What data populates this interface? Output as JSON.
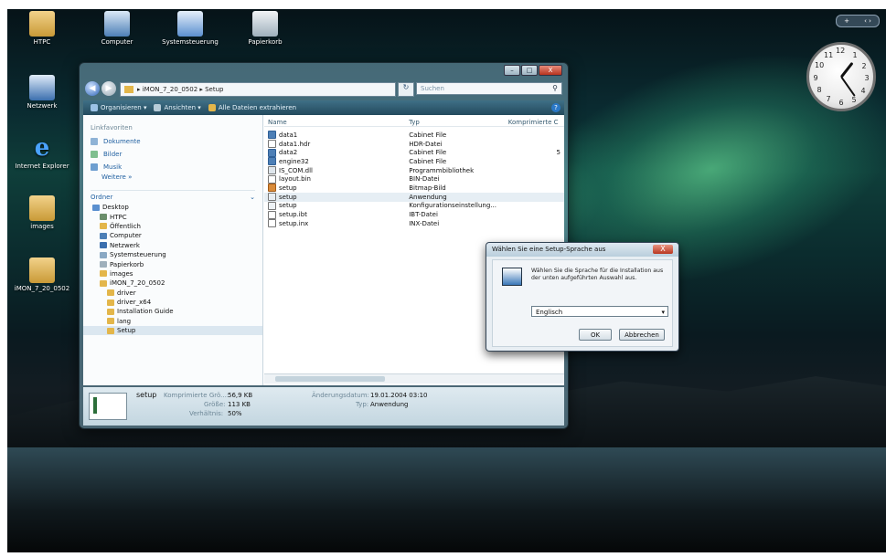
{
  "desktop_icons": [
    {
      "label": "HTPC",
      "icon": "folder-icon"
    },
    {
      "label": "Computer",
      "icon": "computer-icon"
    },
    {
      "label": "Systemsteuerung",
      "icon": "control-panel-icon"
    },
    {
      "label": "Papierkorb",
      "icon": "recycle-bin-icon"
    },
    {
      "label": "Netzwerk",
      "icon": "network-icon"
    },
    {
      "label": "Internet Explorer",
      "icon": "ie-icon"
    },
    {
      "label": "images",
      "icon": "folder-icon"
    },
    {
      "label": "iMON_7_20_0502",
      "icon": "folder-icon"
    }
  ],
  "explorer": {
    "breadcrumb": "▸ iMON_7_20_0502 ▸ Setup",
    "search_placeholder": "Suchen",
    "toolbar": {
      "organize": "Organisieren ▾",
      "views": "Ansichten ▾",
      "extract": "Alle Dateien extrahieren"
    },
    "favorites_header": "Linkfavoriten",
    "favorites": [
      "Dokumente",
      "Bilder",
      "Musik"
    ],
    "more": "Weitere »",
    "folders_header": "Ordner",
    "tree": [
      {
        "label": "Desktop",
        "level": 0
      },
      {
        "label": "HTPC",
        "level": 1
      },
      {
        "label": "Öffentlich",
        "level": 1
      },
      {
        "label": "Computer",
        "level": 1
      },
      {
        "label": "Netzwerk",
        "level": 1
      },
      {
        "label": "Systemsteuerung",
        "level": 1
      },
      {
        "label": "Papierkorb",
        "level": 1
      },
      {
        "label": "images",
        "level": 1
      },
      {
        "label": "iMON_7_20_0502",
        "level": 1
      },
      {
        "label": "driver",
        "level": 2
      },
      {
        "label": "driver_x64",
        "level": 2
      },
      {
        "label": "Installation Guide",
        "level": 2
      },
      {
        "label": "lang",
        "level": 2
      },
      {
        "label": "Setup",
        "level": 2,
        "selected": true
      }
    ],
    "columns": [
      "Name",
      "Typ",
      "Komprimierte C"
    ],
    "files": [
      {
        "name": "data1",
        "type": "Cabinet File",
        "comp": ""
      },
      {
        "name": "data1.hdr",
        "type": "HDR-Datei",
        "comp": ""
      },
      {
        "name": "data2",
        "type": "Cabinet File",
        "comp": "5"
      },
      {
        "name": "engine32",
        "type": "Cabinet File",
        "comp": ""
      },
      {
        "name": "IS_COM.dll",
        "type": "Programmbibliothek",
        "comp": ""
      },
      {
        "name": "layout.bin",
        "type": "BIN-Datei",
        "comp": ""
      },
      {
        "name": "setup",
        "type": "Bitmap-Bild",
        "comp": ""
      },
      {
        "name": "setup",
        "type": "Anwendung",
        "comp": "",
        "highlight": true
      },
      {
        "name": "setup",
        "type": "Konfigurationseinstellung...",
        "comp": ""
      },
      {
        "name": "setup.ibt",
        "type": "IBT-Datei",
        "comp": ""
      },
      {
        "name": "setup.inx",
        "type": "INX-Datei",
        "comp": ""
      }
    ],
    "details": {
      "name": "setup",
      "comp_label": "Komprimierte Grö...:",
      "comp_value": "56,9 KB",
      "size_label": "Größe:",
      "size_value": "113 KB",
      "ratio_label": "Verhältnis:",
      "ratio_value": "50%",
      "date_label": "Änderungsdatum:",
      "date_value": "19.01.2004 03:10",
      "type_label": "Typ:",
      "type_value": "Anwendung"
    }
  },
  "dialog": {
    "title": "Wählen Sie eine Setup-Sprache aus",
    "close": "X",
    "message": "Wählen Sie die Sprache für die Installation aus der unten aufgeführten Auswahl aus.",
    "language": "Englisch",
    "ok": "OK",
    "cancel": "Abbrechen"
  },
  "window_controls": {
    "min": "–",
    "max": "□",
    "close": "X"
  },
  "gadget": {
    "add": "+",
    "nav": "‹ ›"
  },
  "clock": {
    "numbers": [
      "12",
      "1",
      "2",
      "3",
      "4",
      "5",
      "6",
      "7",
      "8",
      "9",
      "10",
      "11"
    ]
  }
}
